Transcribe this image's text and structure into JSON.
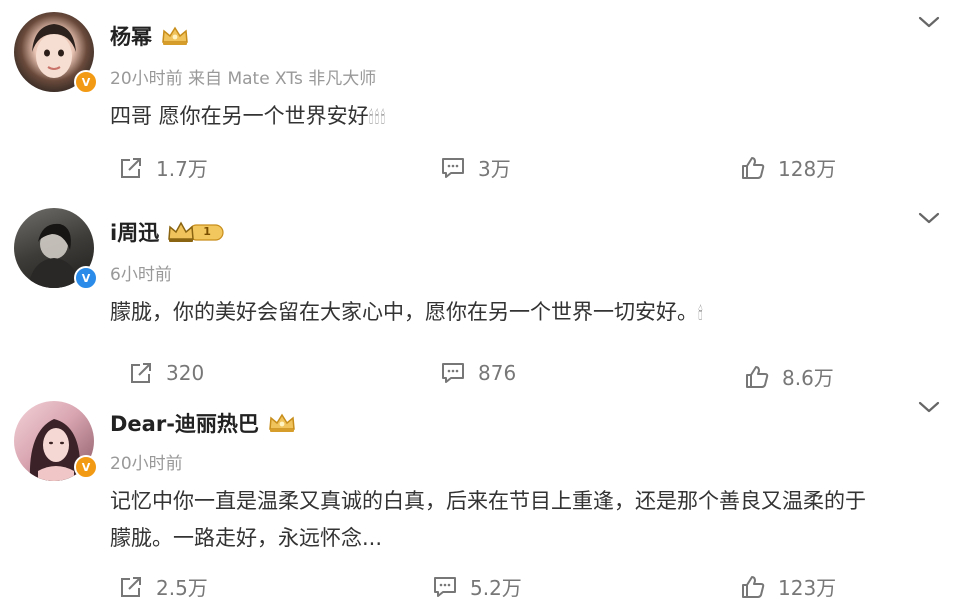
{
  "comments": [
    {
      "username": "杨幂",
      "meta": "20小时前  来自 Mate XTs 非凡大师",
      "verify": "orange",
      "text_lines": [
        "四哥 愿你在另一个世界安好"
      ],
      "emoji_tail": "🕯🕯🕯",
      "repost": "1.7万",
      "comment": "3万",
      "like": "128万"
    },
    {
      "username": "i周迅",
      "badge_level": "1",
      "meta": "6小时前",
      "verify": "blue",
      "text_lines": [
        "朦胧，你的美好会留在大家心中，愿你在另一个世界一切安好。"
      ],
      "emoji_tail": "🕯",
      "repost": "320",
      "comment": "876",
      "like": "8.6万"
    },
    {
      "username": "Dear-迪丽热巴",
      "meta": "20小时前",
      "verify": "orange",
      "text_lines": [
        "记忆中你一直是温柔又真诚的白真，后来在节目上重逢，还是那个善良又温柔的于",
        "朦胧。一路走好，永远怀念..."
      ],
      "repost": "2.5万",
      "comment": "5.2万",
      "like": "123万"
    }
  ],
  "colors": {
    "verify_orange": "#f39a14",
    "verify_blue": "#2a8be8",
    "crown_gold": "#e7b24a",
    "meta_gray": "#999999"
  },
  "icons": {
    "repost": "share-icon",
    "comment": "comment-icon",
    "like": "thumbs-up-icon",
    "menu": "chevron-down-icon"
  }
}
